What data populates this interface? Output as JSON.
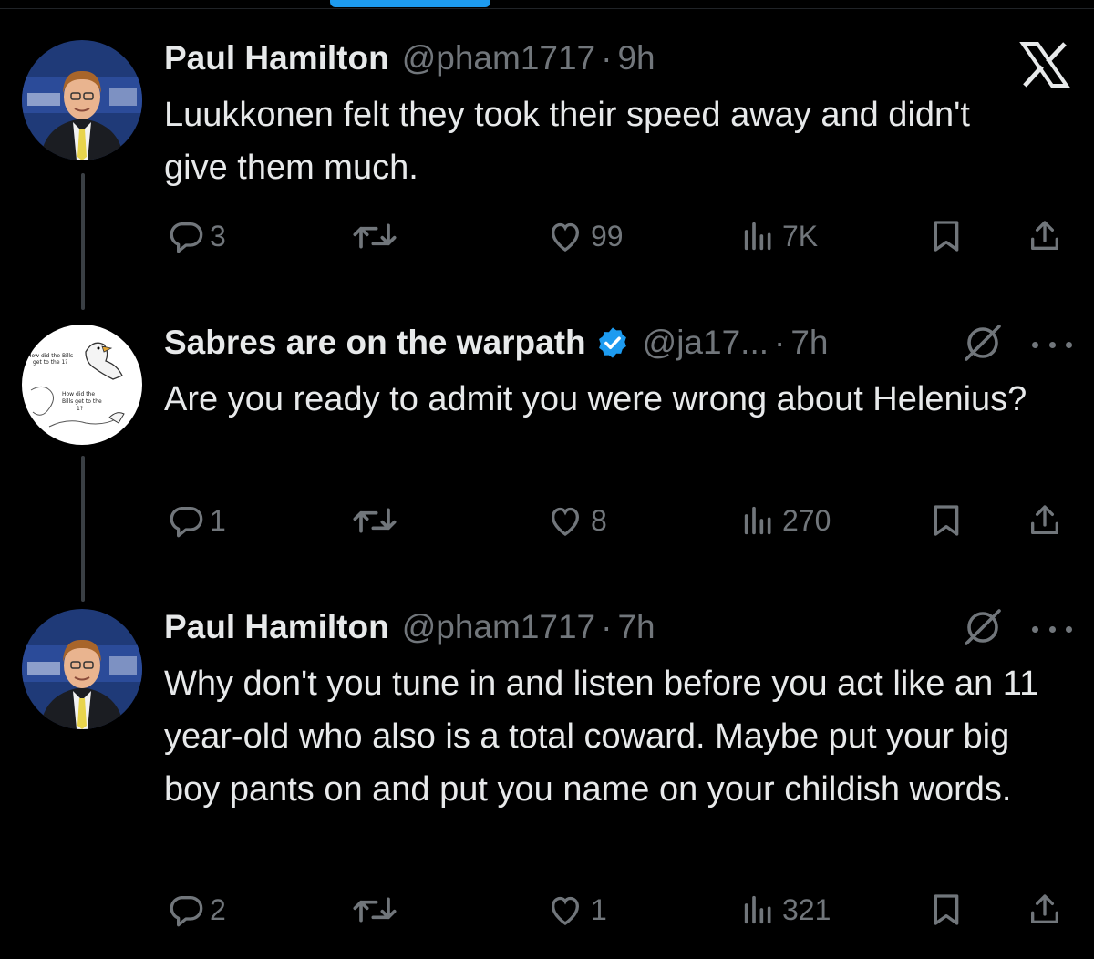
{
  "tweets": [
    {
      "name": "Paul Hamilton",
      "handle": "@pham1717",
      "time": "9h",
      "text": "Luukkonen felt they took their speed away and didn't give them much.",
      "replies": "3",
      "likes": "99",
      "views": "7K",
      "verified": false
    },
    {
      "name": "Sabres are on the warpath",
      "handle": "@ja17...",
      "time": "7h",
      "text": "Are you ready to admit you were wrong about Helenius?",
      "replies": "1",
      "likes": "8",
      "views": "270",
      "verified": true
    },
    {
      "name": "Paul Hamilton",
      "handle": "@pham1717",
      "time": "7h",
      "text": "Why don't you tune in and listen before you act like an 11 year-old who also is a total coward. Maybe put your big boy pants on and put you name on your childish words.",
      "replies": "2",
      "likes": "1",
      "views": "321",
      "verified": false
    }
  ],
  "avatar_meme": {
    "caption_top": "How did the Bills get to the 1?",
    "caption_bottom": "How did the Bills get to the 1?"
  },
  "separator": "·",
  "colors": {
    "background": "#000000",
    "text": "#e7e9ea",
    "secondary": "#71767b",
    "accent": "#1d9bf0"
  },
  "icons": [
    "x-logo-icon",
    "reply-icon",
    "retweet-icon",
    "like-icon",
    "views-icon",
    "bookmark-icon",
    "share-icon",
    "verified-badge-icon",
    "mute-icon",
    "more-icon"
  ]
}
